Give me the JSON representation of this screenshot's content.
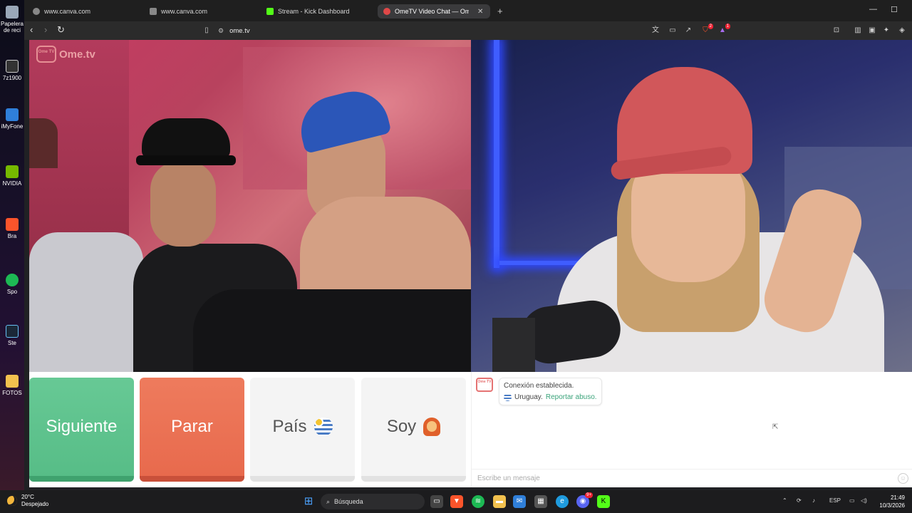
{
  "desktop": {
    "items": [
      {
        "label": "Papelera de reci"
      },
      {
        "label": "7z1900"
      },
      {
        "label": "iMyFone"
      },
      {
        "label": "NVIDIA"
      },
      {
        "label": "Bra"
      },
      {
        "label": "Spo"
      },
      {
        "label": "Ste"
      },
      {
        "label": "FOTOS"
      }
    ]
  },
  "browser": {
    "tabs": [
      {
        "label": "www.canva.com",
        "favicon": "globe-icon",
        "active": false
      },
      {
        "label": "www.canva.com",
        "favicon": "globe-icon",
        "active": false
      },
      {
        "label": "Stream - Kick Dashboard",
        "favicon": "kick-icon",
        "active": false
      },
      {
        "label": "OmeTV Video Chat — Omeg",
        "favicon": "ometv-icon",
        "active": true
      }
    ],
    "new_tab": "+",
    "url": "ome.tv",
    "shield_badge": "2",
    "rewards_badge": "1"
  },
  "site": {
    "logo_box": "Ome TV",
    "logo_text": "Ome.tv"
  },
  "controls": {
    "next": "Siguiente",
    "stop": "Parar",
    "country": "País",
    "gender": "Soy"
  },
  "chat": {
    "avatar": "Ome TV",
    "status": "Conexión establecida.",
    "country": "Uruguay.",
    "report": "Reportar abuso.",
    "placeholder": "Escribe un mensaje"
  },
  "taskbar": {
    "temperature": "20°C",
    "weather": "Despejado",
    "search": "Búsqueda",
    "language": "ESP",
    "time": "21:49",
    "date": "10/3/2026",
    "discord_badge": "9+"
  },
  "colors": {
    "next": "#5cc18c",
    "stop": "#ea7052",
    "neutral_button": "#f4f4f4",
    "report_link": "#3aa37a"
  }
}
